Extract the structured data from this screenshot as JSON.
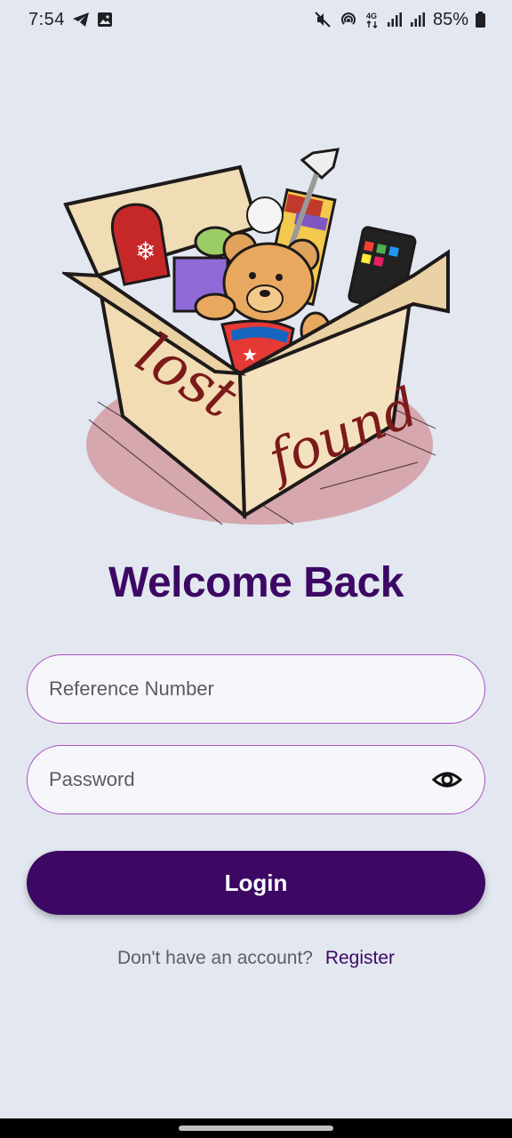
{
  "status_bar": {
    "time": "7:54",
    "battery": "85%",
    "network": "4G",
    "icons": [
      "telegram-icon",
      "gallery-icon",
      "mute-icon",
      "hotspot-icon",
      "4g-icon",
      "signal-icon",
      "signal-icon",
      "battery-icon"
    ]
  },
  "hero": {
    "box_text_1": "lost",
    "box_text_2": "found"
  },
  "title": "Welcome Back",
  "form": {
    "reference_placeholder": "Reference Number",
    "password_placeholder": "Password",
    "login_label": "Login"
  },
  "register": {
    "prompt": "Don't have an account?",
    "link": "Register"
  },
  "colors": {
    "background": "#e2e7f0",
    "primary": "#3c0863",
    "field_border": "#a74fc0"
  }
}
